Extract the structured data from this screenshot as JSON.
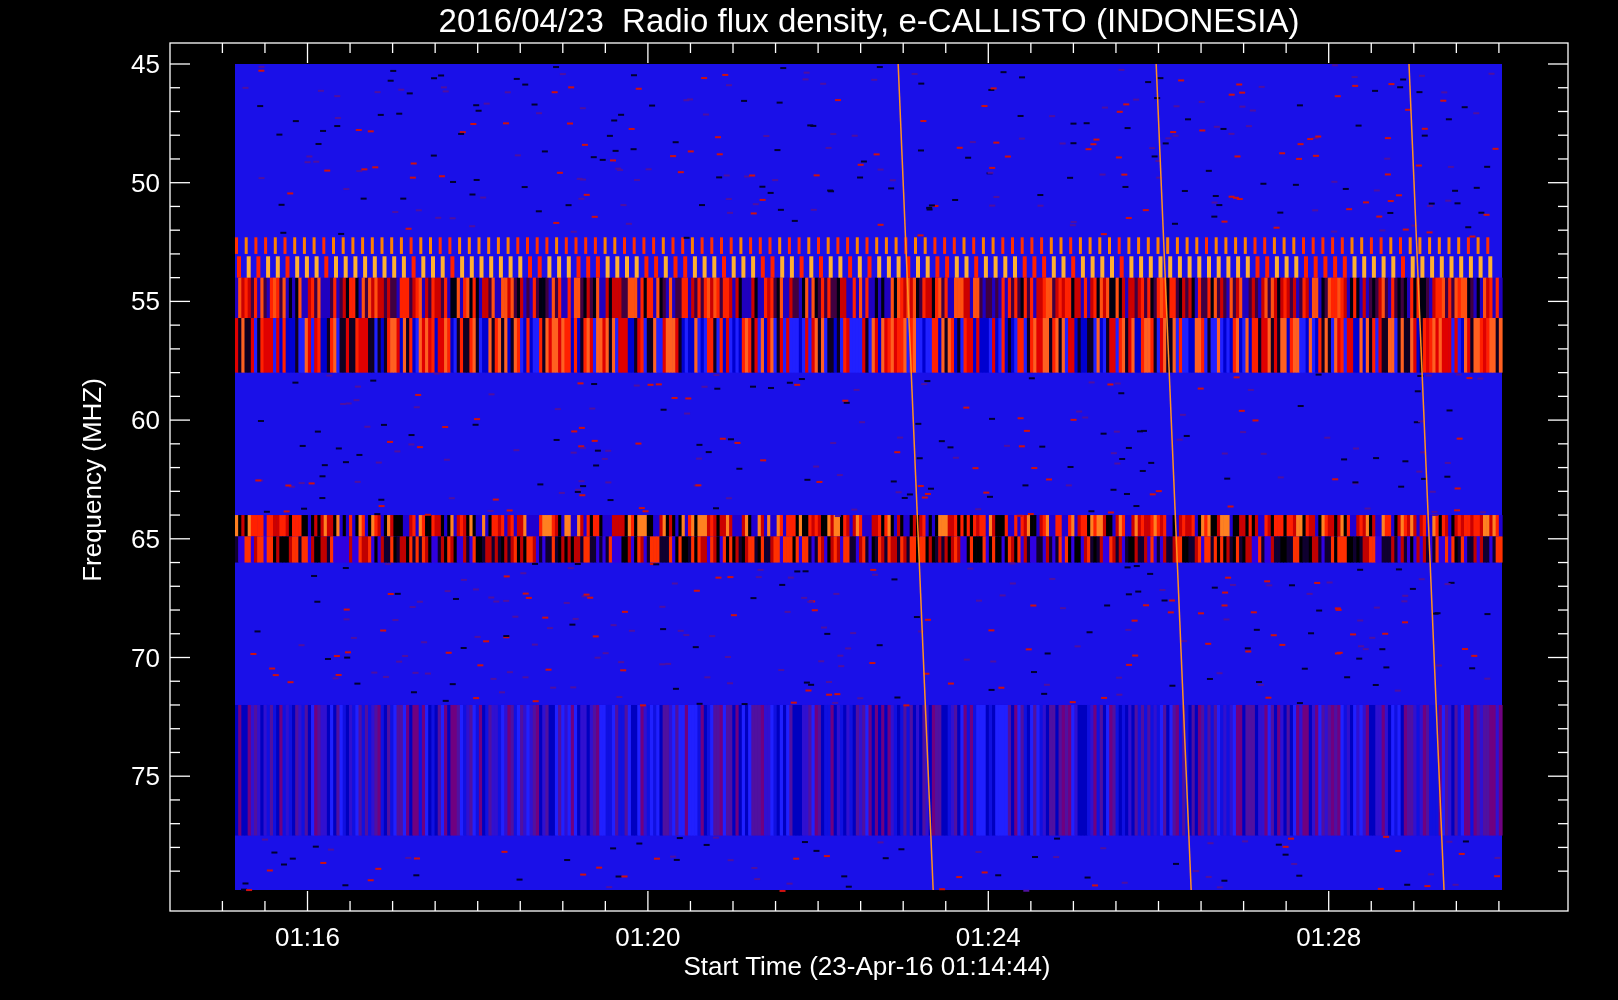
{
  "chart": {
    "title": "2016/04/23  Radio flux density, e-CALLISTO (INDONESIA)",
    "ylabel": "Frequency (MHZ)",
    "xlabel": "Start Time (23-Apr-16 01:14:44)",
    "yticks": [
      "45",
      "50",
      "55",
      "60",
      "65",
      "70",
      "75"
    ],
    "xticks": [
      "01:16",
      "01:20",
      "01:24",
      "01:28"
    ]
  }
}
